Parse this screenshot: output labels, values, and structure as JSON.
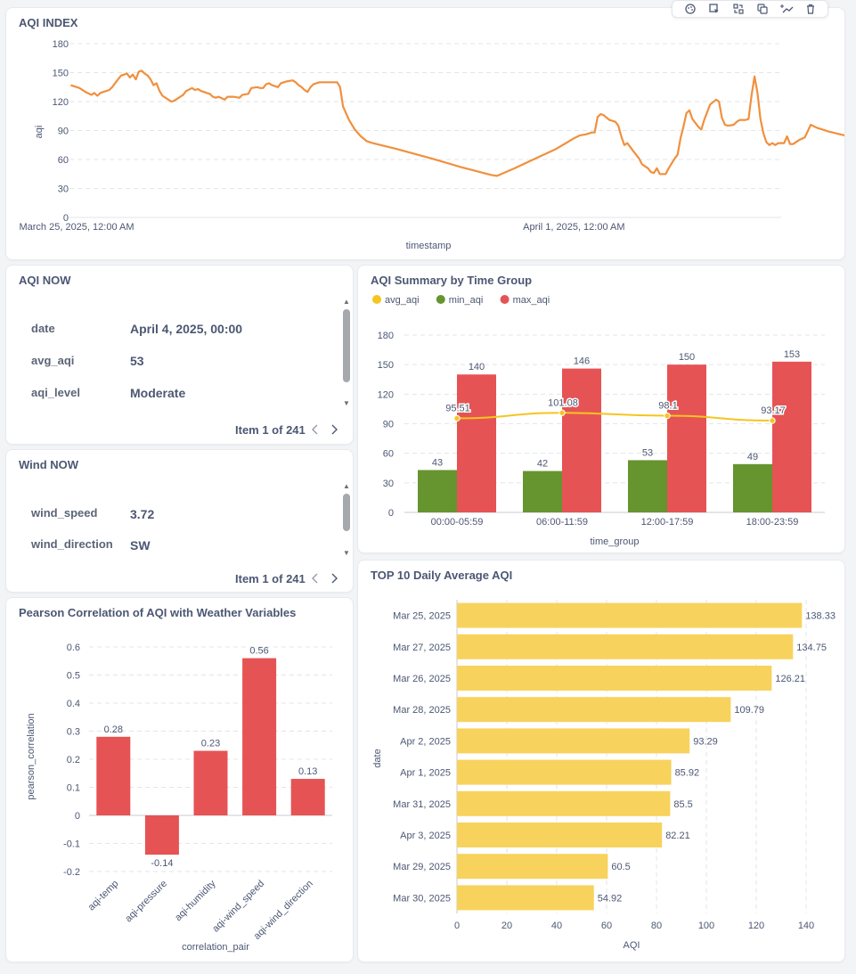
{
  "toolbar": {
    "icons": [
      "palette-icon",
      "click-behavior-icon",
      "replace-icon",
      "duplicate-icon",
      "add-series-icon",
      "trash-icon"
    ]
  },
  "aqi_index": {
    "title": "AQI INDEX",
    "line_color": "#f0903e"
  },
  "aqi_now": {
    "title": "AQI NOW",
    "rows": [
      {
        "key": "date",
        "value": "April 4, 2025, 00:00"
      },
      {
        "key": "avg_aqi",
        "value": "53"
      },
      {
        "key": "aqi_level",
        "value": "Moderate"
      }
    ],
    "pager": "Item 1 of 241"
  },
  "wind_now": {
    "title": "Wind NOW",
    "rows": [
      {
        "key": "wind_speed",
        "value": "3.72"
      },
      {
        "key": "wind_direction",
        "value": "SW"
      }
    ],
    "pager": "Item 1 of 241"
  },
  "summary": {
    "title": "AQI Summary by Time Group"
  },
  "pearson": {
    "title": "Pearson Correlation of AQI with Weather Variables"
  },
  "top10": {
    "title": "TOP 10 Daily Average AQI"
  },
  "chart_data": [
    {
      "id": "aqi-index",
      "type": "line",
      "title": "AQI INDEX",
      "xlabel": "timestamp",
      "ylabel": "aqi",
      "ylim": [
        0,
        180
      ],
      "yticks": [
        0,
        30,
        60,
        90,
        120,
        150,
        180
      ],
      "xticks": [
        {
          "x": 0,
          "label": "March 25, 2025, 12:00 AM"
        },
        {
          "x": 168,
          "label": "April 1, 2025, 12:00 AM"
        }
      ],
      "xlim": [
        0,
        238
      ],
      "color": "#f0903e",
      "points": [
        [
          -2,
          137
        ],
        [
          1,
          134
        ],
        [
          3,
          130
        ],
        [
          5,
          127
        ],
        [
          6,
          129
        ],
        [
          7,
          126
        ],
        [
          8,
          129
        ],
        [
          9,
          130
        ],
        [
          11,
          132
        ],
        [
          12,
          135
        ],
        [
          14,
          143
        ],
        [
          15,
          147
        ],
        [
          17,
          149
        ],
        [
          18,
          145
        ],
        [
          19,
          148
        ],
        [
          20,
          143
        ],
        [
          21,
          151
        ],
        [
          22,
          152
        ],
        [
          23,
          149
        ],
        [
          24,
          147
        ],
        [
          25,
          143
        ],
        [
          26,
          137
        ],
        [
          27,
          139
        ],
        [
          28,
          131
        ],
        [
          29,
          126
        ],
        [
          31,
          122
        ],
        [
          32,
          120
        ],
        [
          33,
          121
        ],
        [
          34,
          123
        ],
        [
          36,
          127
        ],
        [
          37,
          131
        ],
        [
          39,
          134
        ],
        [
          40,
          132
        ],
        [
          41,
          133
        ],
        [
          42,
          131
        ],
        [
          44,
          129
        ],
        [
          45,
          128
        ],
        [
          46,
          125
        ],
        [
          47,
          124
        ],
        [
          48,
          125
        ],
        [
          50,
          122
        ],
        [
          51,
          125
        ],
        [
          53,
          125
        ],
        [
          55,
          124
        ],
        [
          56,
          127
        ],
        [
          58,
          128
        ],
        [
          59,
          134
        ],
        [
          61,
          135
        ],
        [
          62,
          134
        ],
        [
          63,
          134
        ],
        [
          64,
          138
        ],
        [
          65,
          139
        ],
        [
          66,
          137
        ],
        [
          67,
          136
        ],
        [
          68,
          135
        ],
        [
          69,
          139
        ],
        [
          71,
          141
        ],
        [
          73,
          142
        ],
        [
          74,
          140
        ],
        [
          75,
          137
        ],
        [
          76,
          135
        ],
        [
          77,
          132
        ],
        [
          78,
          130
        ],
        [
          79,
          135
        ],
        [
          80,
          138
        ],
        [
          81,
          139
        ],
        [
          82,
          140
        ],
        [
          85,
          140
        ],
        [
          88,
          140
        ],
        [
          89,
          135
        ],
        [
          90,
          115
        ],
        [
          92,
          101
        ],
        [
          94,
          91
        ],
        [
          96,
          84
        ],
        [
          98,
          79
        ],
        [
          100,
          77
        ],
        [
          108,
          71
        ],
        [
          120,
          61
        ],
        [
          130,
          52
        ],
        [
          140,
          44
        ],
        [
          142,
          43
        ],
        [
          148,
          51
        ],
        [
          155,
          61
        ],
        [
          162,
          71
        ],
        [
          168,
          82
        ],
        [
          170,
          85
        ],
        [
          172,
          86
        ],
        [
          173,
          87
        ],
        [
          174,
          88
        ],
        [
          175,
          88
        ],
        [
          176,
          104
        ],
        [
          177,
          107
        ],
        [
          178,
          106
        ],
        [
          180,
          101
        ],
        [
          182,
          99
        ],
        [
          183,
          95
        ],
        [
          184,
          84
        ],
        [
          185,
          75
        ],
        [
          186,
          77
        ],
        [
          188,
          69
        ],
        [
          190,
          61
        ],
        [
          191,
          55
        ],
        [
          192,
          53
        ],
        [
          193,
          51
        ],
        [
          194,
          47
        ],
        [
          195,
          46
        ],
        [
          196,
          51
        ],
        [
          197,
          45
        ],
        [
          198,
          45
        ],
        [
          199,
          45
        ],
        [
          200,
          51
        ],
        [
          202,
          61
        ],
        [
          203,
          65
        ],
        [
          204,
          82
        ],
        [
          205,
          94
        ],
        [
          206,
          108
        ],
        [
          207,
          111
        ],
        [
          208,
          102
        ],
        [
          210,
          94
        ],
        [
          211,
          91
        ],
        [
          212,
          101
        ],
        [
          214,
          117
        ],
        [
          216,
          122
        ],
        [
          217,
          120
        ],
        [
          218,
          103
        ],
        [
          219,
          96
        ],
        [
          220,
          95
        ],
        [
          222,
          96
        ],
        [
          223,
          99
        ],
        [
          224,
          101
        ],
        [
          226,
          101
        ],
        [
          227,
          102
        ],
        [
          228,
          127
        ],
        [
          229,
          146
        ],
        [
          230,
          129
        ],
        [
          231,
          102
        ],
        [
          232,
          87
        ],
        [
          233,
          78
        ],
        [
          234,
          75
        ],
        [
          235,
          77
        ],
        [
          236,
          75
        ],
        [
          237,
          77
        ],
        [
          238,
          77
        ],
        [
          239,
          77
        ],
        [
          240,
          84
        ],
        [
          241,
          76
        ],
        [
          242,
          76
        ],
        [
          244,
          80
        ],
        [
          246,
          83
        ],
        [
          248,
          96
        ],
        [
          250,
          93
        ],
        [
          254,
          89
        ],
        [
          258,
          86
        ],
        [
          262,
          83
        ],
        [
          263,
          81
        ],
        [
          264,
          82
        ],
        [
          265,
          86
        ],
        [
          266,
          90
        ],
        [
          267,
          93
        ],
        [
          268,
          93
        ],
        [
          269,
          87
        ],
        [
          270,
          74
        ],
        [
          271,
          69
        ],
        [
          272,
          68
        ],
        [
          273,
          61
        ],
        [
          274,
          56
        ],
        [
          275,
          54
        ],
        [
          276,
          54
        ],
        [
          277,
          55
        ]
      ]
    },
    {
      "id": "summary",
      "type": "bar",
      "title": "AQI Summary by Time Group",
      "xlabel": "time_group",
      "ylabel": "",
      "ylim": [
        0,
        180
      ],
      "yticks": [
        0,
        30,
        60,
        90,
        120,
        150,
        180
      ],
      "legend": "top-left",
      "categories": [
        "00:00-05:59",
        "06:00-11:59",
        "12:00-17:59",
        "18:00-23:59"
      ],
      "series": [
        {
          "name": "avg_aqi",
          "type": "line",
          "color": "#f5c521",
          "values": [
            95.51,
            101.08,
            98.1,
            93.17
          ]
        },
        {
          "name": "min_aqi",
          "type": "bar",
          "color": "#66942f",
          "values": [
            43,
            42,
            53,
            49
          ]
        },
        {
          "name": "max_aqi",
          "type": "bar",
          "color": "#e65354",
          "values": [
            140,
            146,
            150,
            153
          ]
        }
      ]
    },
    {
      "id": "pearson",
      "type": "bar",
      "title": "Pearson Correlation of AQI with Weather Variables",
      "xlabel": "correlation_pair",
      "ylabel": "pearson_correlation",
      "ylim": [
        -0.2,
        0.6
      ],
      "yticks": [
        -0.2,
        -0.1,
        0,
        0.1,
        0.2,
        0.3,
        0.4,
        0.5,
        0.6
      ],
      "color": "#e65354",
      "categories": [
        "aqi-temp",
        "aqi-pressure",
        "aqi-humidity",
        "aqi-wind_speed",
        "aqi-wind_direction"
      ],
      "values": [
        0.28,
        -0.14,
        0.23,
        0.56,
        0.13
      ]
    },
    {
      "id": "top10",
      "type": "bar",
      "orientation": "horizontal",
      "title": "TOP 10 Daily Average AQI",
      "xlabel": "AQI",
      "ylabel": "date",
      "xlim": [
        0,
        140
      ],
      "xticks": [
        0,
        20,
        40,
        60,
        80,
        100,
        120,
        140
      ],
      "color": "#f7d35d",
      "categories": [
        "Mar 25, 2025",
        "Mar 27, 2025",
        "Mar 26, 2025",
        "Mar 28, 2025",
        "Apr 2, 2025",
        "Apr 1, 2025",
        "Mar 31, 2025",
        "Apr 3, 2025",
        "Mar 29, 2025",
        "Mar 30, 2025"
      ],
      "values": [
        138.33,
        134.75,
        126.21,
        109.79,
        93.29,
        85.92,
        85.5,
        82.21,
        60.5,
        54.92
      ]
    }
  ]
}
